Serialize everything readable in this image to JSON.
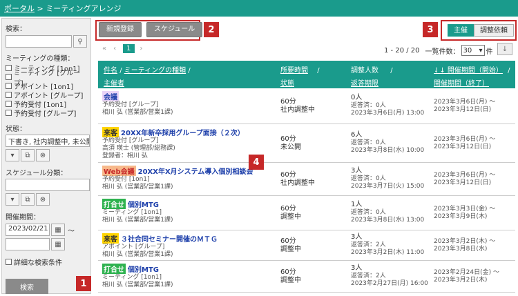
{
  "breadcrumb": {
    "portal": "ポータル",
    "sep": ">",
    "current": "ミーティングアレンジ"
  },
  "sidebar": {
    "search_label": "検索：",
    "meeting_type_label": "ミーティングの種類：",
    "meeting_types": [
      "ミーティング [1on1]",
      "ミーティング [グループ]",
      "アポイント [1on1]",
      "アポイント [グループ]",
      "予約受付 [1on1]",
      "予約受付 [グループ]"
    ],
    "status_label": "状態：",
    "status_value": "下書き, 社内調整中, 未公開,",
    "schedule_label": "スケジュール分類：",
    "period_label": "開催期間：",
    "period_from": "2023/02/21",
    "tilde": "～",
    "detail_label": "詳細な検索条件",
    "search_button": "検索"
  },
  "toolbar": {
    "new_label": "新規登録",
    "schedule_label": "スケジュール"
  },
  "toggle": {
    "host": "主催",
    "request": "調整依頼"
  },
  "pager": {
    "first": "«",
    "prev": "‹",
    "page": "1",
    "next": "›",
    "range": "1 - 20 / 20",
    "per_page_label": "一覧件数：",
    "per_page": "30",
    "unit": "件"
  },
  "badges": {
    "b1": "1",
    "b2": "2",
    "b3": "3",
    "b4": "4"
  },
  "headers": {
    "name": "件名",
    "type": "ミーティングの種類",
    "organizer": "主催者",
    "duration": "所要時間",
    "status": "状態",
    "count": "調整人数",
    "reply_deadline": "返答期限",
    "period_start": "⇃↓ 開催期間（開始）",
    "period_end": "開催期間（終了）",
    "slash": "/"
  },
  "rows": [
    {
      "tag": "会議",
      "title": "",
      "type": "予約受付 [グループ]",
      "organizer": "相川 弘 (営業部/営業1課)",
      "extra": "",
      "duration": "60分",
      "status": "社内調整中",
      "count": "0人",
      "replied": "返答済：0人",
      "deadline": "2023年3月6日(月) 13:00",
      "start": "2023年3月6日(月) ～",
      "end": "2023年3月12日(日)"
    },
    {
      "tag": "来客",
      "title": "20XX年新卒採用グループ面接（２次）",
      "type": "予約受付 [グループ]",
      "organizer": "高須 瑛士 (管理部/総務課)",
      "extra": "登録者：相川 弘",
      "duration": "60分",
      "status": "未公開",
      "count": "6人",
      "replied": "返答済：0人",
      "deadline": "2023年3月8日(水) 10:00",
      "start": "2023年3月6日(月) ～",
      "end": "2023年3月12日(日)"
    },
    {
      "tag": "Web会議",
      "title": "20XX年X月システム導入個別相談会",
      "type": "予約受付 [1on1]",
      "organizer": "相川 弘 (営業部/営業1課)",
      "extra": "",
      "duration": "60分",
      "status": "社内調整中",
      "count": "3人",
      "replied": "返答済：0人",
      "deadline": "2023年3月7日(火) 15:00",
      "start": "2023年3月6日(月) ～",
      "end": "2023年3月12日(日)"
    },
    {
      "tag": "打合せ",
      "title": "個別MTG",
      "type": "ミーティング [1on1]",
      "organizer": "相川 弘 (営業部/営業1課)",
      "extra": "",
      "duration": "60分",
      "status": "調整中",
      "count": "1人",
      "replied": "返答済：0人",
      "deadline": "2023年3月8日(水) 13:00",
      "start": "2023年3月3日(金) ～",
      "end": "2023年3月9日(木)"
    },
    {
      "tag": "来客",
      "title": "３社合同セミナー開催のＭＴＧ",
      "type": "アポイント [グループ]",
      "organizer": "相川 弘 (営業部/営業1課)",
      "extra": "",
      "duration": "60分",
      "status": "調整中",
      "count": "3人",
      "replied": "返答済：2人",
      "deadline": "2023年3月2日(木) 11:00",
      "start": "2023年3月2日(木) ～",
      "end": "2023年3月8日(水)"
    },
    {
      "tag": "打合せ",
      "title": "個別MTG",
      "type": "ミーティング [1on1]",
      "organizer": "相川 弘 (営業部/営業1課)",
      "extra": "",
      "duration": "60分",
      "status": "調整中",
      "count": "3人",
      "replied": "返答済：2人",
      "deadline": "2023年2月27日(月) 16:00",
      "start": "2023年2月24日(金) ～",
      "end": "2023年3月2日(木)"
    }
  ],
  "colors": {
    "accent": "#1a9b8c",
    "highlight": "#c62828",
    "tag_meeting": "#e9d4f7",
    "tag_guest": "#ffd400",
    "tag_web": "#f7b98b",
    "tag_mtg": "#2eb24f"
  }
}
